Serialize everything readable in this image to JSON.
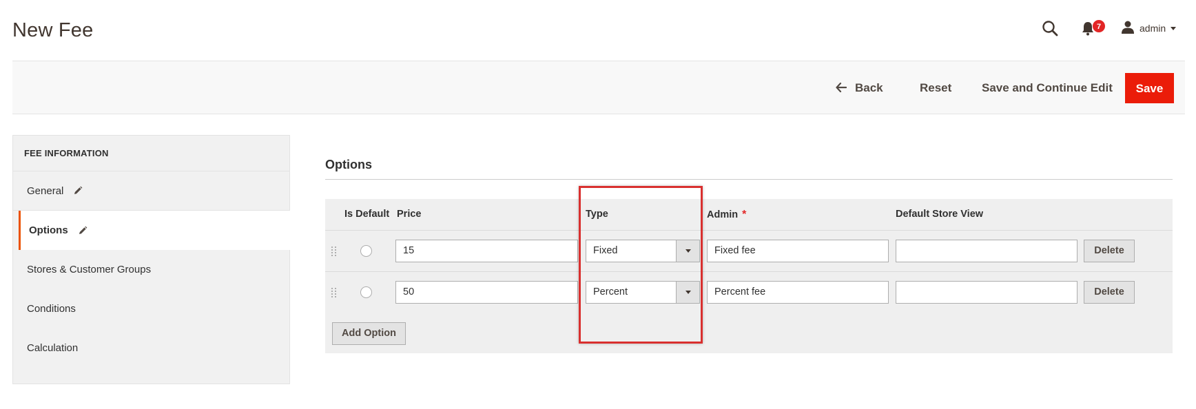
{
  "header": {
    "title": "New Fee",
    "notifications_count": "7",
    "user_name": "admin"
  },
  "actions": {
    "back_label": "Back",
    "reset_label": "Reset",
    "save_continue_label": "Save and Continue Edit",
    "save_label": "Save"
  },
  "sidebar": {
    "title": "FEE INFORMATION",
    "items": [
      {
        "label": "General"
      },
      {
        "label": "Options"
      },
      {
        "label": "Stores & Customer Groups"
      },
      {
        "label": "Conditions"
      },
      {
        "label": "Calculation"
      }
    ]
  },
  "options": {
    "section_title": "Options",
    "columns": {
      "is_default": "Is Default",
      "price": "Price",
      "type": "Type",
      "admin": "Admin",
      "admin_required": "*",
      "default_store_view": "Default Store View"
    },
    "rows": [
      {
        "price": "15",
        "type": "Fixed",
        "admin": "Fixed fee",
        "store_view": "",
        "delete_label": "Delete"
      },
      {
        "price": "50",
        "type": "Percent",
        "admin": "Percent fee",
        "store_view": "",
        "delete_label": "Delete"
      }
    ],
    "add_option_label": "Add Option"
  },
  "colors": {
    "accent_save": "#eb1c09",
    "badge": "#e22626",
    "highlight": "#d9302f",
    "active_tab_border": "#eb5202"
  }
}
